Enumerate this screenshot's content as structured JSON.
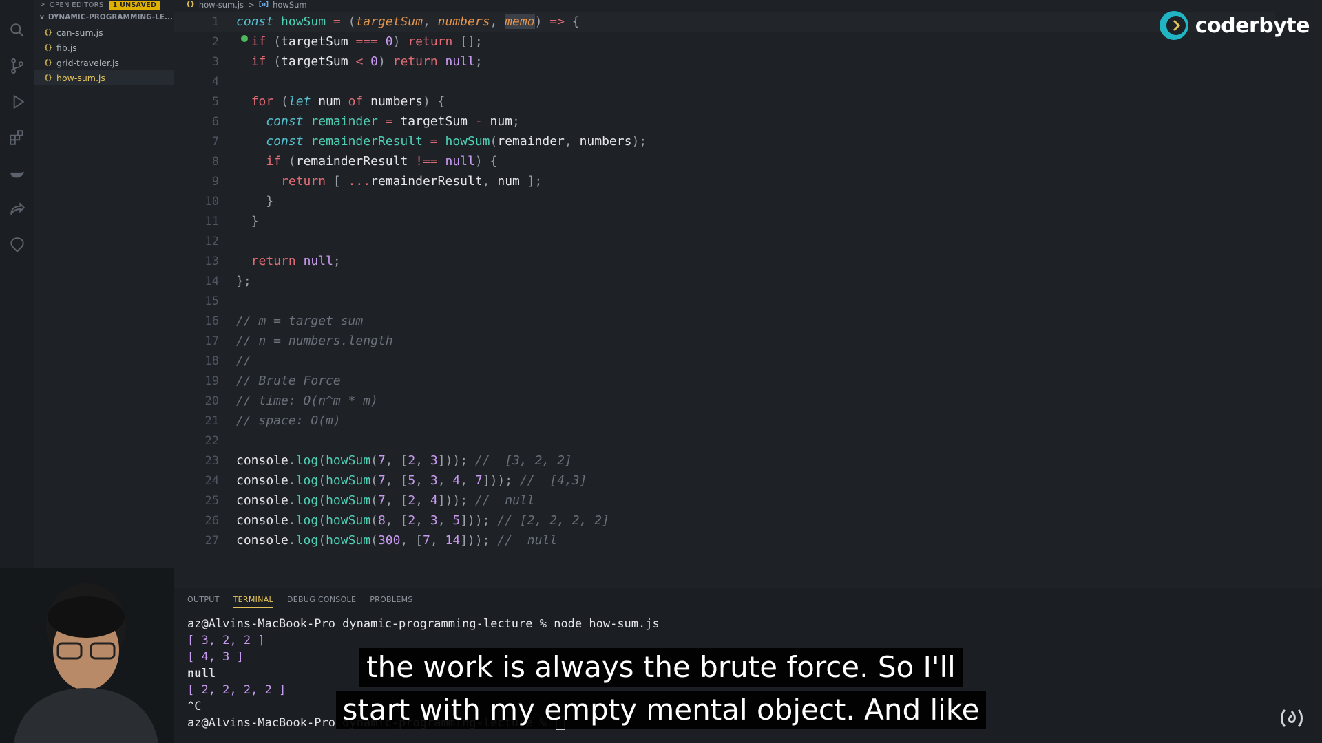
{
  "sidebar": {
    "open_editors_label": "OPEN EDITORS",
    "unsaved_badge": "1 UNSAVED",
    "folder_label": "DYNAMIC-PROGRAMMING-LE...",
    "file_badge": "{}",
    "files": [
      "can-sum.js",
      "fib.js",
      "grid-traveler.js",
      "how-sum.js"
    ],
    "active_file": "how-sum.js"
  },
  "breadcrumb": {
    "file": "how-sum.js",
    "separator": ">",
    "symbol_badge": "[ø]",
    "symbol": "howSum"
  },
  "editor": {
    "line_numbers": [
      "1",
      "2",
      "3",
      "4",
      "5",
      "6",
      "7",
      "8",
      "9",
      "10",
      "11",
      "12",
      "13",
      "14",
      "15",
      "16",
      "17",
      "18",
      "19",
      "20",
      "21",
      "22",
      "23",
      "24",
      "25",
      "26",
      "27"
    ]
  },
  "logo": {
    "text": "coderbyte"
  },
  "panel": {
    "tabs": [
      "OUTPUT",
      "TERMINAL",
      "DEBUG CONSOLE",
      "PROBLEMS"
    ],
    "active_tab": "TERMINAL",
    "terminal": {
      "prompt_line": "az@Alvins-MacBook-Pro dynamic-programming-lecture % node how-sum.js",
      "out1": "[ 3, 2, 2 ]",
      "out2": "[ 4, 3 ]",
      "out3": "null",
      "out4": "[ 2, 2, 2, 2 ]",
      "out5": "^C",
      "prompt2": "az@Alvins-MacBook-Pro dynamic-programming-lecture % "
    }
  },
  "subtitles": {
    "line1": "the work is always the brute force. So I'll",
    "line2": "start with my empty mental object. And like"
  },
  "colors": {
    "accent": "#e3c25a",
    "logo": "#21b5c4",
    "background": "#1e2227"
  }
}
